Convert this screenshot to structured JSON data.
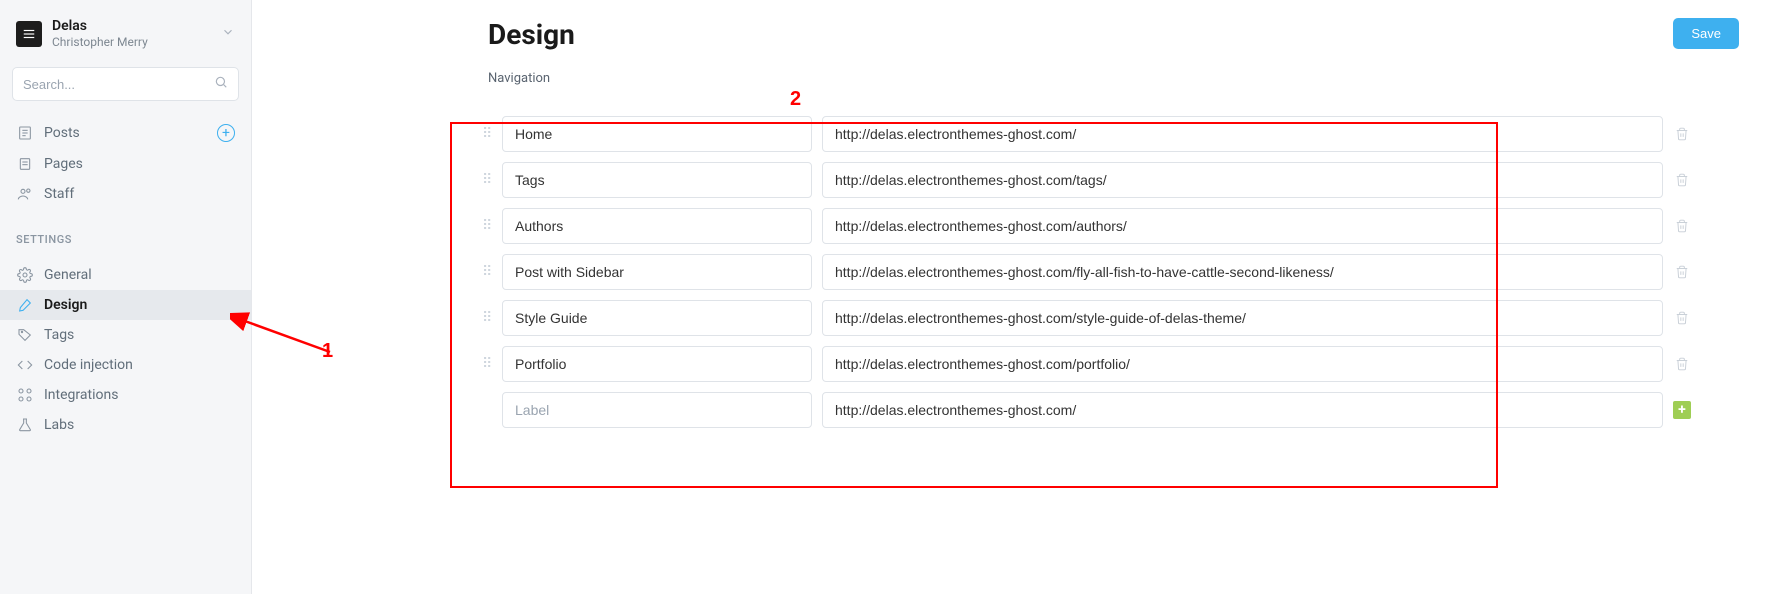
{
  "site": {
    "title": "Delas",
    "user": "Christopher Merry"
  },
  "search": {
    "placeholder": "Search..."
  },
  "sidebar": {
    "items": [
      {
        "label": "Posts",
        "icon": "posts"
      },
      {
        "label": "Pages",
        "icon": "pages"
      },
      {
        "label": "Staff",
        "icon": "staff"
      }
    ],
    "settings_heading": "SETTINGS",
    "settings": [
      {
        "label": "General",
        "icon": "gear"
      },
      {
        "label": "Design",
        "icon": "brush"
      },
      {
        "label": "Tags",
        "icon": "tag"
      },
      {
        "label": "Code injection",
        "icon": "code"
      },
      {
        "label": "Integrations",
        "icon": "integrations"
      },
      {
        "label": "Labs",
        "icon": "flask"
      }
    ]
  },
  "page": {
    "title": "Design",
    "save_label": "Save",
    "section_heading": "Navigation"
  },
  "navigation": {
    "rows": [
      {
        "label": "Home",
        "url": "http://delas.electronthemes-ghost.com/"
      },
      {
        "label": "Tags",
        "url": "http://delas.electronthemes-ghost.com/tags/"
      },
      {
        "label": "Authors",
        "url": "http://delas.electronthemes-ghost.com/authors/"
      },
      {
        "label": "Post with Sidebar",
        "url": "http://delas.electronthemes-ghost.com/fly-all-fish-to-have-cattle-second-likeness/"
      },
      {
        "label": "Style Guide",
        "url": "http://delas.electronthemes-ghost.com/style-guide-of-delas-theme/"
      },
      {
        "label": "Portfolio",
        "url": "http://delas.electronthemes-ghost.com/portfolio/"
      }
    ],
    "new_row": {
      "label_placeholder": "Label",
      "url_value": "http://delas.electronthemes-ghost.com/"
    }
  },
  "annotations": {
    "one": "1",
    "two": "2"
  }
}
